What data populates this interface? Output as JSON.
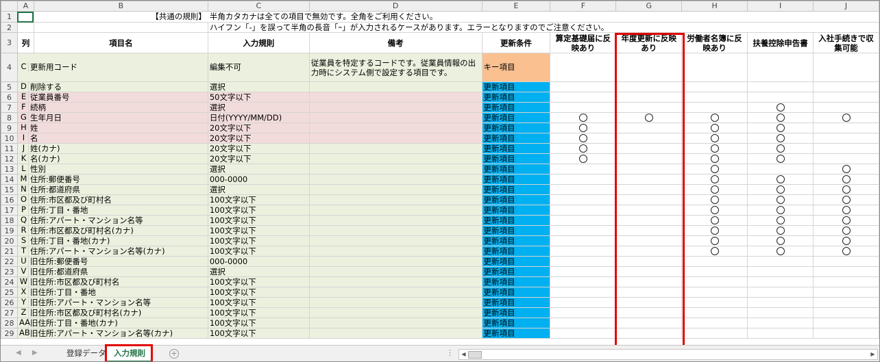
{
  "col_letters": [
    "A",
    "B",
    "C",
    "D",
    "E",
    "F",
    "G",
    "H",
    "I",
    "J"
  ],
  "notes": {
    "row1_label": "【共通の規則】",
    "row1_text": "半角カタカナは全ての項目で無効です。全角をご利用ください。",
    "row2_text": "ハイフン「-」を誤って半角の長音「ｰ」が入力されるケースがあります。エラーとなりますのでご注意ください。"
  },
  "headers": {
    "a": "列",
    "b": "項目名",
    "c": "入力規則",
    "d": "備考",
    "e": "更新条件",
    "f": "算定基礎届に反映あり",
    "g": "年度更新に反映あり",
    "h": "労働者名簿に反映あり",
    "i": "扶養控除申告書",
    "j": "入社手続きで収集可能"
  },
  "row4": {
    "num": "4",
    "col": "C",
    "item": "更新用コード",
    "rule": "編集不可",
    "note": "従業員を特定するコードです。従業員情報の出力時にシステム側で設定する項目です。",
    "cond": "キー項目"
  },
  "rows": [
    {
      "num": "5",
      "col": "D",
      "item": "削除する",
      "rule": "選択",
      "cond": "更新項目",
      "fill": "green",
      "f": "",
      "g": "",
      "h": "",
      "i": "",
      "j": ""
    },
    {
      "num": "6",
      "col": "E",
      "item": "従業員番号",
      "rule": "50文字以下",
      "cond": "更新項目",
      "fill": "pink",
      "f": "",
      "g": "",
      "h": "",
      "i": "",
      "j": ""
    },
    {
      "num": "7",
      "col": "F",
      "item": "続柄",
      "rule": "選択",
      "cond": "更新項目",
      "fill": "pink",
      "f": "",
      "g": "",
      "h": "",
      "i": "○",
      "j": ""
    },
    {
      "num": "8",
      "col": "G",
      "item": "生年月日",
      "rule": "日付(YYYY/MM/DD)",
      "cond": "更新項目",
      "fill": "pink",
      "f": "○",
      "g": "○",
      "h": "○",
      "i": "○",
      "j": "○"
    },
    {
      "num": "9",
      "col": "H",
      "item": "姓",
      "rule": "20文字以下",
      "cond": "更新項目",
      "fill": "pink",
      "f": "○",
      "g": "",
      "h": "○",
      "i": "○",
      "j": ""
    },
    {
      "num": "10",
      "col": "I",
      "item": "名",
      "rule": "20文字以下",
      "cond": "更新項目",
      "fill": "pink",
      "f": "○",
      "g": "",
      "h": "○",
      "i": "○",
      "j": ""
    },
    {
      "num": "11",
      "col": "J",
      "item": "姓(カナ)",
      "rule": "20文字以下",
      "cond": "更新項目",
      "fill": "green",
      "f": "○",
      "g": "",
      "h": "○",
      "i": "○",
      "j": ""
    },
    {
      "num": "12",
      "col": "K",
      "item": "名(カナ)",
      "rule": "20文字以下",
      "cond": "更新項目",
      "fill": "green",
      "f": "○",
      "g": "",
      "h": "○",
      "i": "○",
      "j": ""
    },
    {
      "num": "13",
      "col": "L",
      "item": "性別",
      "rule": "選択",
      "cond": "更新項目",
      "fill": "green",
      "f": "",
      "g": "",
      "h": "○",
      "i": "",
      "j": "○"
    },
    {
      "num": "14",
      "col": "M",
      "item": "住所:郵便番号",
      "rule": "000-0000",
      "cond": "更新項目",
      "fill": "green",
      "f": "",
      "g": "",
      "h": "○",
      "i": "○",
      "j": "○"
    },
    {
      "num": "15",
      "col": "N",
      "item": "住所:都道府県",
      "rule": "選択",
      "cond": "更新項目",
      "fill": "green",
      "f": "",
      "g": "",
      "h": "○",
      "i": "○",
      "j": "○"
    },
    {
      "num": "16",
      "col": "O",
      "item": "住所:市区都及び町村名",
      "rule": "100文字以下",
      "cond": "更新項目",
      "fill": "green",
      "f": "",
      "g": "",
      "h": "○",
      "i": "○",
      "j": "○"
    },
    {
      "num": "17",
      "col": "P",
      "item": "住所:丁目・番地",
      "rule": "100文字以下",
      "cond": "更新項目",
      "fill": "green",
      "f": "",
      "g": "",
      "h": "○",
      "i": "○",
      "j": "○"
    },
    {
      "num": "18",
      "col": "Q",
      "item": "住所:アパート・マンション名等",
      "rule": "100文字以下",
      "cond": "更新項目",
      "fill": "green",
      "f": "",
      "g": "",
      "h": "○",
      "i": "○",
      "j": "○"
    },
    {
      "num": "19",
      "col": "R",
      "item": "住所:市区都及び町村名(カナ)",
      "rule": "100文字以下",
      "cond": "更新項目",
      "fill": "green",
      "f": "",
      "g": "",
      "h": "○",
      "i": "○",
      "j": "○"
    },
    {
      "num": "20",
      "col": "S",
      "item": "住所:丁目・番地(カナ)",
      "rule": "100文字以下",
      "cond": "更新項目",
      "fill": "green",
      "f": "",
      "g": "",
      "h": "○",
      "i": "○",
      "j": "○"
    },
    {
      "num": "21",
      "col": "T",
      "item": "住所:アパート・マンション名等(カナ)",
      "rule": "100文字以下",
      "cond": "更新項目",
      "fill": "green",
      "f": "",
      "g": "",
      "h": "○",
      "i": "○",
      "j": "○"
    },
    {
      "num": "22",
      "col": "U",
      "item": "旧住所:郵便番号",
      "rule": "000-0000",
      "cond": "更新項目",
      "fill": "green",
      "f": "",
      "g": "",
      "h": "",
      "i": "",
      "j": ""
    },
    {
      "num": "23",
      "col": "V",
      "item": "旧住所:都道府県",
      "rule": "選択",
      "cond": "更新項目",
      "fill": "green",
      "f": "",
      "g": "",
      "h": "",
      "i": "",
      "j": ""
    },
    {
      "num": "24",
      "col": "W",
      "item": "旧住所:市区都及び町村名",
      "rule": "100文字以下",
      "cond": "更新項目",
      "fill": "green",
      "f": "",
      "g": "",
      "h": "",
      "i": "",
      "j": ""
    },
    {
      "num": "25",
      "col": "X",
      "item": "旧住所:丁目・番地",
      "rule": "100文字以下",
      "cond": "更新項目",
      "fill": "green",
      "f": "",
      "g": "",
      "h": "",
      "i": "",
      "j": ""
    },
    {
      "num": "26",
      "col": "Y",
      "item": "旧住所:アパート・マンション名等",
      "rule": "100文字以下",
      "cond": "更新項目",
      "fill": "green",
      "f": "",
      "g": "",
      "h": "",
      "i": "",
      "j": ""
    },
    {
      "num": "27",
      "col": "Z",
      "item": "旧住所:市区都及び町村名(カナ)",
      "rule": "100文字以下",
      "cond": "更新項目",
      "fill": "green",
      "f": "",
      "g": "",
      "h": "",
      "i": "",
      "j": ""
    },
    {
      "num": "28",
      "col": "AA",
      "item": "旧住所:丁目・番地(カナ)",
      "rule": "100文字以下",
      "cond": "更新項目",
      "fill": "green",
      "f": "",
      "g": "",
      "h": "",
      "i": "",
      "j": ""
    },
    {
      "num": "29",
      "col": "AB",
      "item": "旧住所:アパート・マンション名等(カナ)",
      "rule": "100文字以下",
      "cond": "更新項目",
      "fill": "green",
      "f": "",
      "g": "",
      "h": "",
      "i": "",
      "j": ""
    }
  ],
  "tabs": {
    "tab1": "登録データ",
    "tab2": "入力規則",
    "add": "+",
    "dots": "⋮"
  },
  "colors": {
    "pink": "#f2dcdb",
    "green": "#ebf1de",
    "blue": "#00b0f0",
    "orange": "#fac090",
    "highlight": "#e00000",
    "excel_green": "#217346"
  }
}
